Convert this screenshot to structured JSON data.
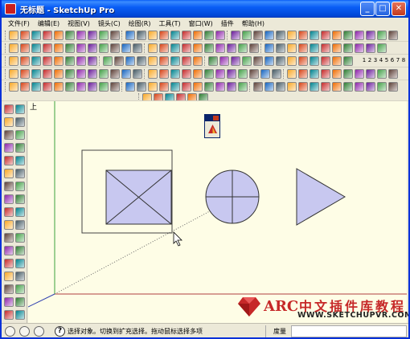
{
  "window": {
    "title": "无标题 - SketchUp Pro",
    "controls": [
      "minimize-button",
      "maximize-button",
      "close-button"
    ]
  },
  "menubar": {
    "items": [
      {
        "label": "文件(F)"
      },
      {
        "label": "编辑(E)"
      },
      {
        "label": "视图(V)"
      },
      {
        "label": "镜头(C)"
      },
      {
        "label": "绘图(R)"
      },
      {
        "label": "工具(T)"
      },
      {
        "label": "窗口(W)"
      },
      {
        "label": "插件"
      },
      {
        "label": "帮助(H)"
      }
    ]
  },
  "toolbar": {
    "numbered_buttons": [
      "1",
      "2",
      "3",
      "4",
      "5",
      "6",
      "7",
      "8"
    ]
  },
  "viewport": {
    "axis_label": "上",
    "shapes": [
      "rectangle-with-x",
      "circle-with-cross",
      "triangle"
    ]
  },
  "statusbar": {
    "help_glyph": "?",
    "text": "选择对象。切换到扩充选择。拖动鼠标选择多项",
    "measure_label": "度量",
    "measure_value": ""
  },
  "watermark": {
    "brand": "ARC",
    "chinese_text": "中文插件库教程",
    "url": "WWW.SKETCHUPVR.COM"
  },
  "colors": {
    "title_bar": "#0a5ef6",
    "viewport_bg": "#fefde6",
    "shape_fill": "#c8c8f0",
    "watermark_red": "#c62828"
  }
}
